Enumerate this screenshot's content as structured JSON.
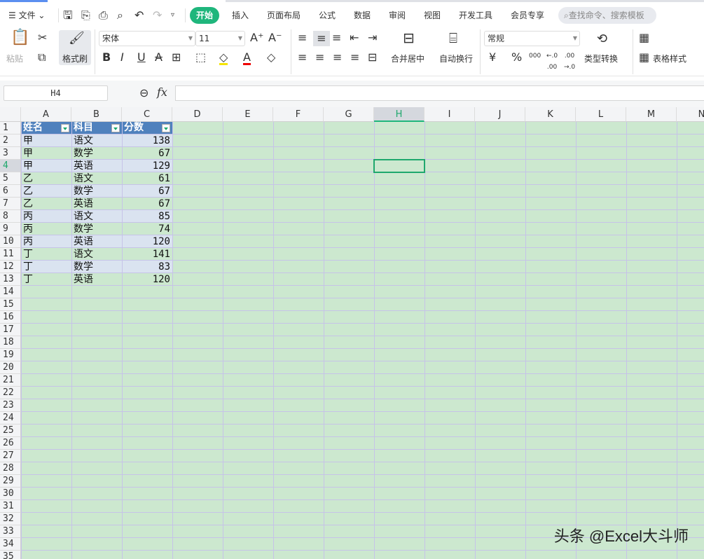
{
  "menu": {
    "file": "文件",
    "tabs": [
      "开始",
      "插入",
      "页面布局",
      "公式",
      "数据",
      "审阅",
      "视图",
      "开发工具",
      "会员专享"
    ],
    "search_placeholder": "查找命令、搜索模板"
  },
  "ribbon": {
    "paste": "粘贴",
    "format_painter": "格式刷",
    "font": "宋体",
    "font_size": "11",
    "merge_center": "合并居中",
    "wrap_text": "自动换行",
    "number_format": "常规",
    "currency": "¥",
    "percent": "%",
    "thousands": "000",
    "type_convert": "类型转换",
    "table_style": "表格样式"
  },
  "formula_bar": {
    "name_box": "H4",
    "fx": "fx",
    "value": ""
  },
  "sheet": {
    "columns": [
      "A",
      "B",
      "C",
      "D",
      "E",
      "F",
      "G",
      "H",
      "I",
      "J",
      "K",
      "L",
      "M",
      "N"
    ],
    "selected_column": "H",
    "selected_row": 4,
    "row_count": 35,
    "headers": [
      "姓名",
      "科目",
      "分数"
    ],
    "rows": [
      [
        "甲",
        "语文",
        "138"
      ],
      [
        "甲",
        "数学",
        "67"
      ],
      [
        "甲",
        "英语",
        "129"
      ],
      [
        "乙",
        "语文",
        "61"
      ],
      [
        "乙",
        "数学",
        "67"
      ],
      [
        "乙",
        "英语",
        "67"
      ],
      [
        "丙",
        "语文",
        "85"
      ],
      [
        "丙",
        "数学",
        "74"
      ],
      [
        "丙",
        "英语",
        "120"
      ],
      [
        "丁",
        "语文",
        "141"
      ],
      [
        "丁",
        "数学",
        "83"
      ],
      [
        "丁",
        "英语",
        "120"
      ]
    ]
  },
  "watermark": "头条 @Excel大斗师",
  "colors": {
    "accent": "#1fb67c",
    "table_header": "#4f81bd",
    "band": "#dae3f0",
    "sheet_bg": "#cce8cf"
  }
}
